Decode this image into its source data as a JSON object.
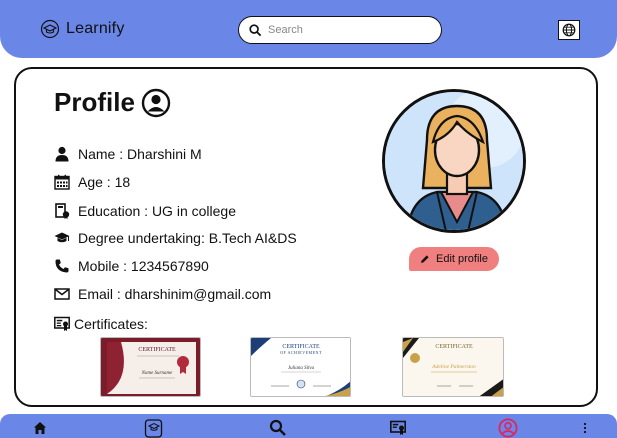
{
  "header": {
    "brand": "Learnify",
    "search_placeholder": "Search"
  },
  "profile": {
    "title": "Profile",
    "name": "Name : Dharshini M",
    "age": "Age : 18",
    "education": "Education : UG in college",
    "degree": "Degree undertaking: B.Tech AI&DS",
    "mobile": "Mobile : 1234567890",
    "email": "Email : dharshinim@gmail.com",
    "certificates_label": "Certificates:",
    "edit_label": "Edit profile"
  },
  "certificates": [
    {
      "heading": "CERTIFICATE",
      "name": "Name Surname",
      "style": "maroon"
    },
    {
      "heading": "CERTIFICATE",
      "subheading": "OF ACHIEVEMENT",
      "name": "Juliana Silva",
      "style": "blue"
    },
    {
      "heading": "CERTIFICATE",
      "name": "Adeline Palmerston",
      "style": "gold"
    }
  ],
  "colors": {
    "header_bg": "#6a86e6",
    "edit_button": "#f08080",
    "avatar_bg": "#cde4fb",
    "active_nav": "#e0245e"
  },
  "bottom_nav": [
    "home-icon",
    "learn-icon",
    "search-icon",
    "certificates-icon",
    "profile-icon",
    "more-icon"
  ]
}
